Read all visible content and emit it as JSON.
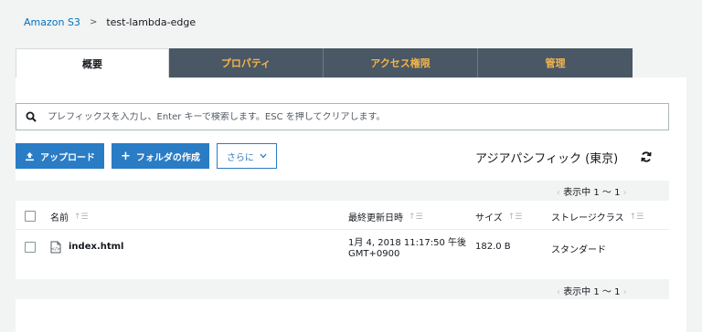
{
  "breadcrumb": {
    "root": "Amazon S3",
    "separator": ">",
    "current": "test-lambda-edge"
  },
  "tabs": [
    {
      "label": "概要",
      "active": true
    },
    {
      "label": "プロパティ",
      "active": false
    },
    {
      "label": "アクセス権限",
      "active": false
    },
    {
      "label": "管理",
      "active": false
    }
  ],
  "search": {
    "placeholder": "プレフィックスを入力し、Enter キーで検索します。ESC を押してクリアします。",
    "value": ""
  },
  "toolbar": {
    "upload_label": "アップロード",
    "create_folder_label": "フォルダの作成",
    "more_label": "さらに"
  },
  "region": "アジアパシフィック (東京)",
  "pagination": {
    "label": "表示中 1 〜 1"
  },
  "table": {
    "columns": {
      "name": "名前",
      "last_modified": "最終更新日時",
      "size": "サイズ",
      "storage_class": "ストレージクラス"
    },
    "rows": [
      {
        "name": "index.html",
        "last_modified_line1": "1月 4, 2018 11:17:50 午後",
        "last_modified_line2": "GMT+0900",
        "size": "182.0 B",
        "storage_class": "スタンダード"
      }
    ]
  },
  "colors": {
    "link": "#0073bb",
    "tab_inactive_bg": "#4a5866",
    "tab_inactive_text": "#f4b54a",
    "primary_button": "#2a7cc5"
  }
}
